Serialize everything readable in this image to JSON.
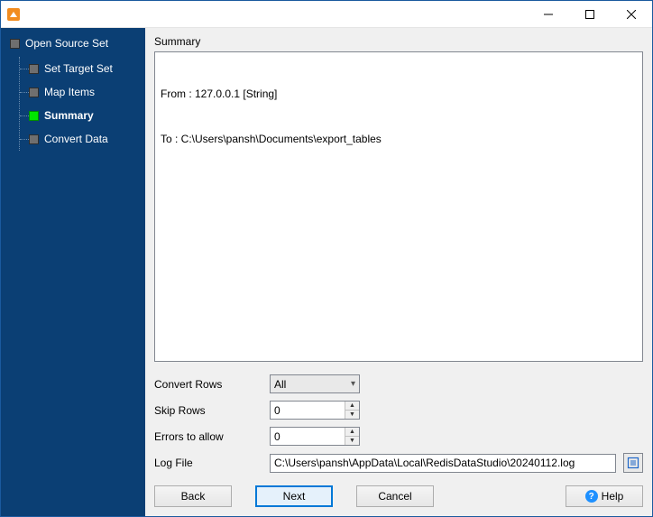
{
  "sidebar": {
    "root": "Open Source Set",
    "items": [
      {
        "label": "Set Target Set",
        "active": false
      },
      {
        "label": "Map Items",
        "active": false
      },
      {
        "label": "Summary",
        "active": true
      },
      {
        "label": "Convert Data",
        "active": false
      }
    ]
  },
  "main": {
    "title": "Summary",
    "summary_line1": "From : 127.0.0.1 [String]",
    "summary_line2": "To : C:\\Users\\pansh\\Documents\\export_tables"
  },
  "options": {
    "convert_rows_label": "Convert Rows",
    "convert_rows_value": "All",
    "skip_rows_label": "Skip Rows",
    "skip_rows_value": "0",
    "errors_label": "Errors to allow",
    "errors_value": "0",
    "log_file_label": "Log File",
    "log_file_value": "C:\\Users\\pansh\\AppData\\Local\\RedisDataStudio\\20240112.log"
  },
  "footer": {
    "back": "Back",
    "next": "Next",
    "cancel": "Cancel",
    "help": "Help"
  }
}
